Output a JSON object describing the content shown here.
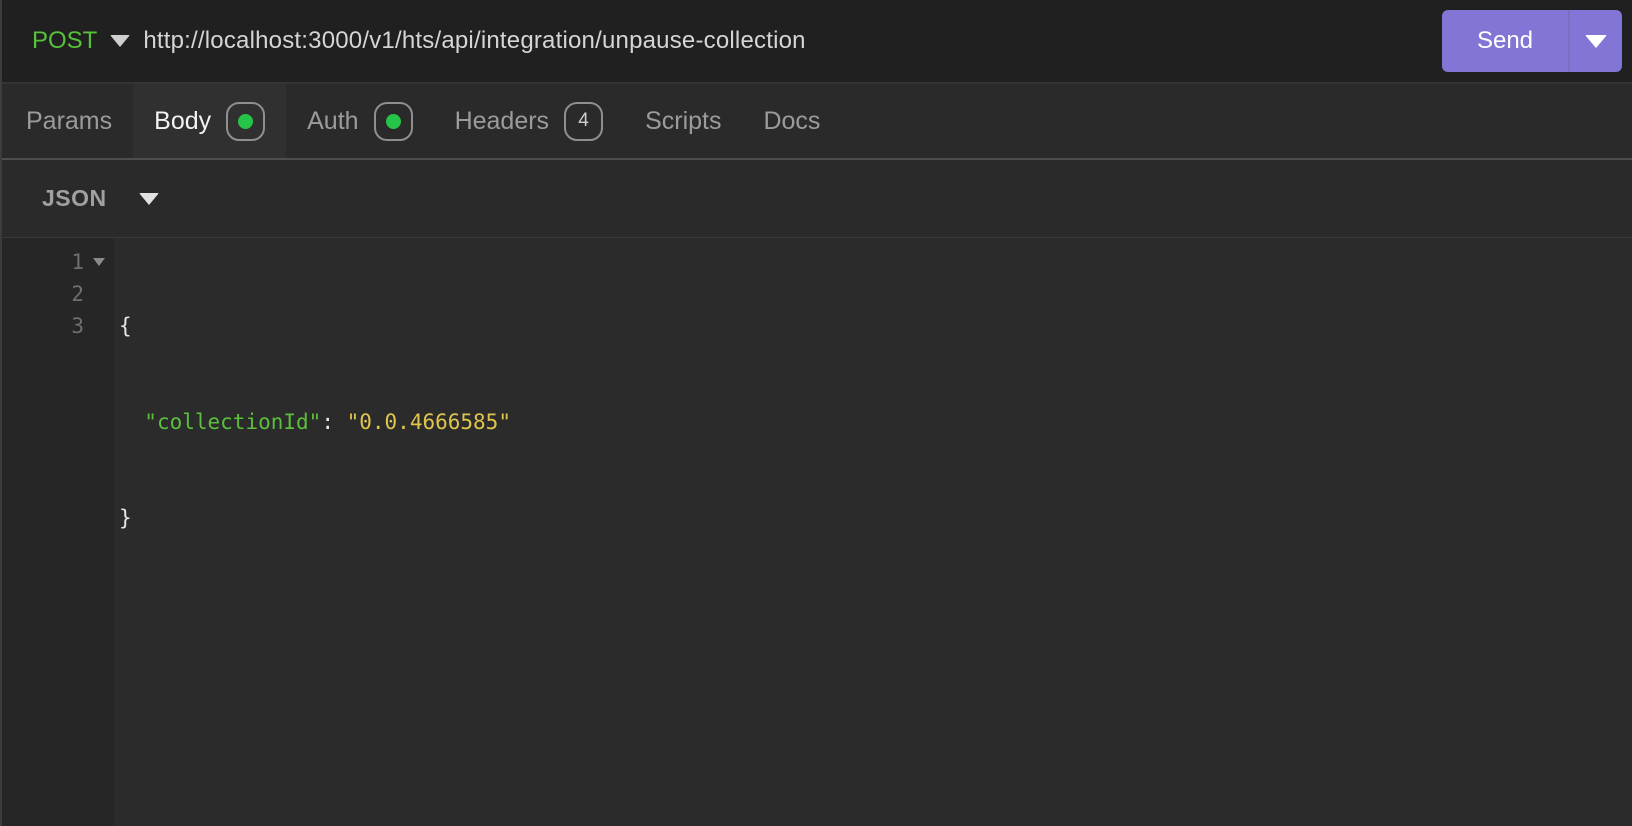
{
  "colors": {
    "method-green": "#57c13b",
    "send-purple": "#8176d5",
    "badge-dot-green": "#26c448",
    "json-key": "#5cbe3d",
    "json-value": "#dfc54b",
    "editor-text": "#e6e6e6"
  },
  "request_bar": {
    "method": "POST",
    "url": "http://localhost:3000/v1/hts/api/integration/unpause-collection",
    "send_label": "Send"
  },
  "tabs": {
    "items": [
      {
        "label": "Params"
      },
      {
        "label": "Body",
        "badge": "dot",
        "active": true
      },
      {
        "label": "Auth",
        "badge": "dot"
      },
      {
        "label": "Headers",
        "badge": "count",
        "count": "4"
      },
      {
        "label": "Scripts"
      },
      {
        "label": "Docs"
      }
    ]
  },
  "body_panel": {
    "content_type": "JSON"
  },
  "editor": {
    "lines": [
      {
        "num": "1",
        "code": [
          {
            "t": "{",
            "c": "punct"
          }
        ]
      },
      {
        "num": "2",
        "code": [
          {
            "t": "  ",
            "c": "punct"
          },
          {
            "t": "\"collectionId\"",
            "c": "key"
          },
          {
            "t": ": ",
            "c": "punct"
          },
          {
            "t": "\"0.0.4666585\"",
            "c": "value"
          }
        ]
      },
      {
        "num": "3",
        "code": [
          {
            "t": "}",
            "c": "punct"
          }
        ]
      }
    ]
  }
}
